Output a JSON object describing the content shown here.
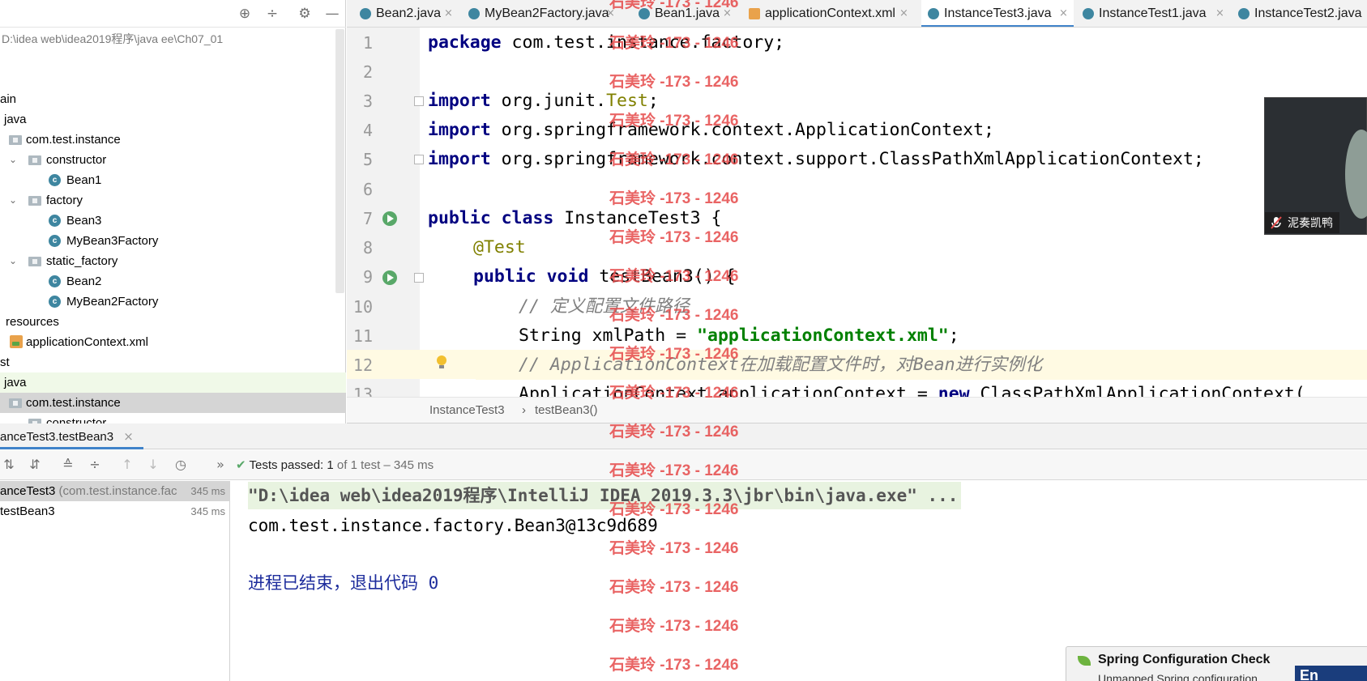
{
  "project": {
    "path": "D:\\idea web\\idea2019程序\\java ee\\Ch07_01",
    "toolbar_icons": [
      "locate-icon",
      "collapse-all-icon",
      "gear-icon",
      "minimize-icon"
    ],
    "tree": [
      {
        "label": "ain",
        "icon": "",
        "chevron": ""
      },
      {
        "label": "java",
        "icon": "folder",
        "chevron": ""
      },
      {
        "label": "com.test.instance",
        "icon": "package",
        "chevron": ""
      },
      {
        "label": "constructor",
        "icon": "package",
        "chevron": "v"
      },
      {
        "label": "Bean1",
        "icon": "class",
        "chevron": ""
      },
      {
        "label": "factory",
        "icon": "package",
        "chevron": "v"
      },
      {
        "label": "Bean3",
        "icon": "class",
        "chevron": ""
      },
      {
        "label": "MyBean3Factory",
        "icon": "class",
        "chevron": ""
      },
      {
        "label": "static_factory",
        "icon": "package",
        "chevron": "v"
      },
      {
        "label": "Bean2",
        "icon": "class",
        "chevron": ""
      },
      {
        "label": "MyBean2Factory",
        "icon": "class",
        "chevron": ""
      },
      {
        "label": "resources",
        "icon": "",
        "chevron": ""
      },
      {
        "label": "applicationContext.xml",
        "icon": "xml",
        "chevron": ""
      },
      {
        "label": "st",
        "icon": "",
        "chevron": ""
      },
      {
        "label": "java",
        "icon": "folder",
        "chevron": ""
      },
      {
        "label": "com.test.instance",
        "icon": "package",
        "chevron": ""
      },
      {
        "label": "constructor",
        "icon": "package",
        "chevron": ""
      }
    ]
  },
  "tabs": [
    {
      "label": "Bean2.java",
      "close": "×"
    },
    {
      "label": "MyBean2Factory.java",
      "close": "×"
    },
    {
      "label": "Bean1.java",
      "close": "×"
    },
    {
      "label": "applicationContext.xml",
      "close": "×"
    },
    {
      "label": "InstanceTest3.java",
      "close": "×",
      "active": true
    },
    {
      "label": "InstanceTest1.java",
      "close": "×"
    },
    {
      "label": "InstanceTest2.java",
      "close": ""
    }
  ],
  "editor": {
    "line_numbers": [
      "1",
      "2",
      "3",
      "4",
      "5",
      "6",
      "7",
      "8",
      "9",
      "10",
      "11",
      "12",
      "13"
    ],
    "lines": {
      "l1_kw": "package",
      "l1_rest": " com.test.instance.factory;",
      "l3_kw": "import",
      "l3_a": " org.junit.",
      "l3_ann": "Test",
      "l3_b": ";",
      "l4_kw": "import",
      "l4_rest": " org.springframework.context.ApplicationContext;",
      "l5_kw": "import",
      "l5_rest": " org.springframework.context.support.ClassPathXmlApplicationContext;",
      "l7_kw": "public class",
      "l7_rest": " InstanceTest3 {",
      "l8_ann": "@Test",
      "l9_kw": "public void",
      "l9_rest": " testBean3() {",
      "l10_cmt": "// 定义配置文件路径",
      "l11_a": "String xmlPath = ",
      "l11_str": "\"applicationContext.xml\"",
      "l11_b": ";",
      "l12_cmt": "// ApplicationContext在加载配置文件时，对Bean进行实例化",
      "l13_a": "ApplicationContext applicationContext = ",
      "l13_kw": "new",
      "l13_b": " ClassPathXmlApplicationContext("
    },
    "breadcrumb": [
      "InstanceTest3",
      "›",
      "testBean3()"
    ]
  },
  "webcam": {
    "name": "泥奏凯鸭"
  },
  "run": {
    "tab_label": "anceTest3.testBean3",
    "tab_close": "×",
    "status_check": "✔",
    "status_main": "Tests passed: ",
    "status_count": "1",
    "status_sub": " of 1 test – 345 ms",
    "more": "»",
    "tree": [
      {
        "name": "anceTest3",
        "pkg": " (com.test.instance.fac",
        "time": "345 ms"
      },
      {
        "name": "testBean3",
        "pkg": "",
        "time": "345 ms"
      }
    ],
    "console": {
      "cmd": "\"D:\\idea web\\idea2019程序\\IntelliJ IDEA 2019.3.3\\jbr\\bin\\java.exe\" ...",
      "output": "com.test.instance.factory.Bean3@13c9d689",
      "exit": "进程已结束，退出代码 0"
    }
  },
  "notification": {
    "title": "Spring Configuration Check",
    "body": "Unmapped Spring configuration"
  },
  "ime": "En",
  "watermark": "石美玲 -173 - 1246",
  "colors": {
    "accent": "#4083c9",
    "passed": "#59a869",
    "keyword": "#000080",
    "string": "#008000",
    "watermark": "#e64a4a"
  }
}
